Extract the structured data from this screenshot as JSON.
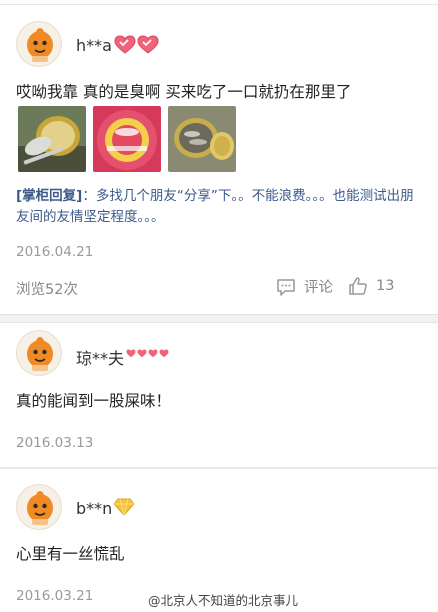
{
  "reviews": [
    {
      "username": "h**a",
      "badge": "hearts",
      "content": "哎呦我靠 真的是臭啊 买来吃了一口就扔在那里了",
      "photos": [
        "can-photo",
        "tin-label-photo",
        "herring-photo"
      ],
      "reply": {
        "tag": "[掌柜回复]",
        "text": "：多找几个朋友“分享”下。。不能浪费。。。也能测试出朋友间的友情坚定程度。。。"
      },
      "date": "2016.04.21",
      "views_label": "浏览52次",
      "comment_label": "评论",
      "like_count": "13"
    },
    {
      "username": "琼**夫",
      "badge": "small-hearts",
      "content": "真的能闻到一股屎味！",
      "date": "2016.03.13"
    },
    {
      "username": "b**n",
      "badge": "diamond",
      "content": "心里有一丝慌乱",
      "date": "2016.03.21"
    }
  ],
  "watermark": "@北京人不知道的北京事儿",
  "colors": {
    "heart": "#f0647a",
    "diamond": "#f5c23a",
    "reply": "#3b5a8a",
    "meta": "#999999"
  }
}
